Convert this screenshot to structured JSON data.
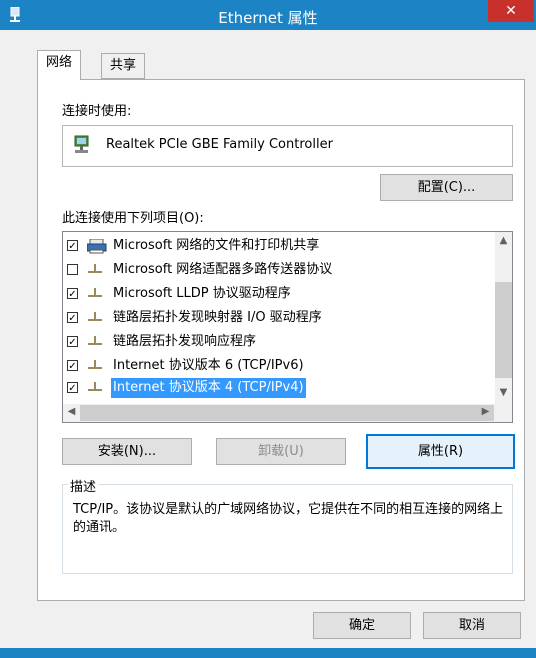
{
  "window": {
    "title": "Ethernet 属性",
    "close_glyph": "✕",
    "accent_color": "#1c83c4"
  },
  "tabs": [
    {
      "label": "网络",
      "active": true
    },
    {
      "label": "共享",
      "active": false
    }
  ],
  "connect_using": {
    "label": "连接时使用:",
    "adapter_name": "Realtek PCIe GBE Family Controller",
    "adapter_icon": "network-adapter-icon",
    "configure_button": "配置(C)..."
  },
  "items_section": {
    "label": "此连接使用下列项目(O):",
    "items": [
      {
        "label": "Microsoft 网络的文件和打印机共享",
        "checked": true,
        "icon": "printer-icon",
        "selected": false
      },
      {
        "label": "Microsoft 网络适配器多路传送器协议",
        "checked": false,
        "icon": "protocol-icon",
        "selected": false
      },
      {
        "label": "Microsoft LLDP 协议驱动程序",
        "checked": true,
        "icon": "protocol-icon",
        "selected": false
      },
      {
        "label": "链路层拓扑发现映射器 I/O 驱动程序",
        "checked": true,
        "icon": "protocol-icon",
        "selected": false
      },
      {
        "label": "链路层拓扑发现响应程序",
        "checked": true,
        "icon": "protocol-icon",
        "selected": false
      },
      {
        "label": "Internet 协议版本 6 (TCP/IPv6)",
        "checked": true,
        "icon": "protocol-icon",
        "selected": false
      },
      {
        "label": "Internet 协议版本 4 (TCP/IPv4)",
        "checked": true,
        "icon": "protocol-icon",
        "selected": true
      }
    ]
  },
  "buttons": {
    "install": "安装(N)...",
    "uninstall": "卸载(U)",
    "properties": "属性(R)"
  },
  "description": {
    "title": "描述",
    "text": "TCP/IP。该协议是默认的广域网络协议，它提供在不同的相互连接的网络上的通讯。"
  },
  "footer": {
    "ok": "确定",
    "cancel": "取消"
  }
}
